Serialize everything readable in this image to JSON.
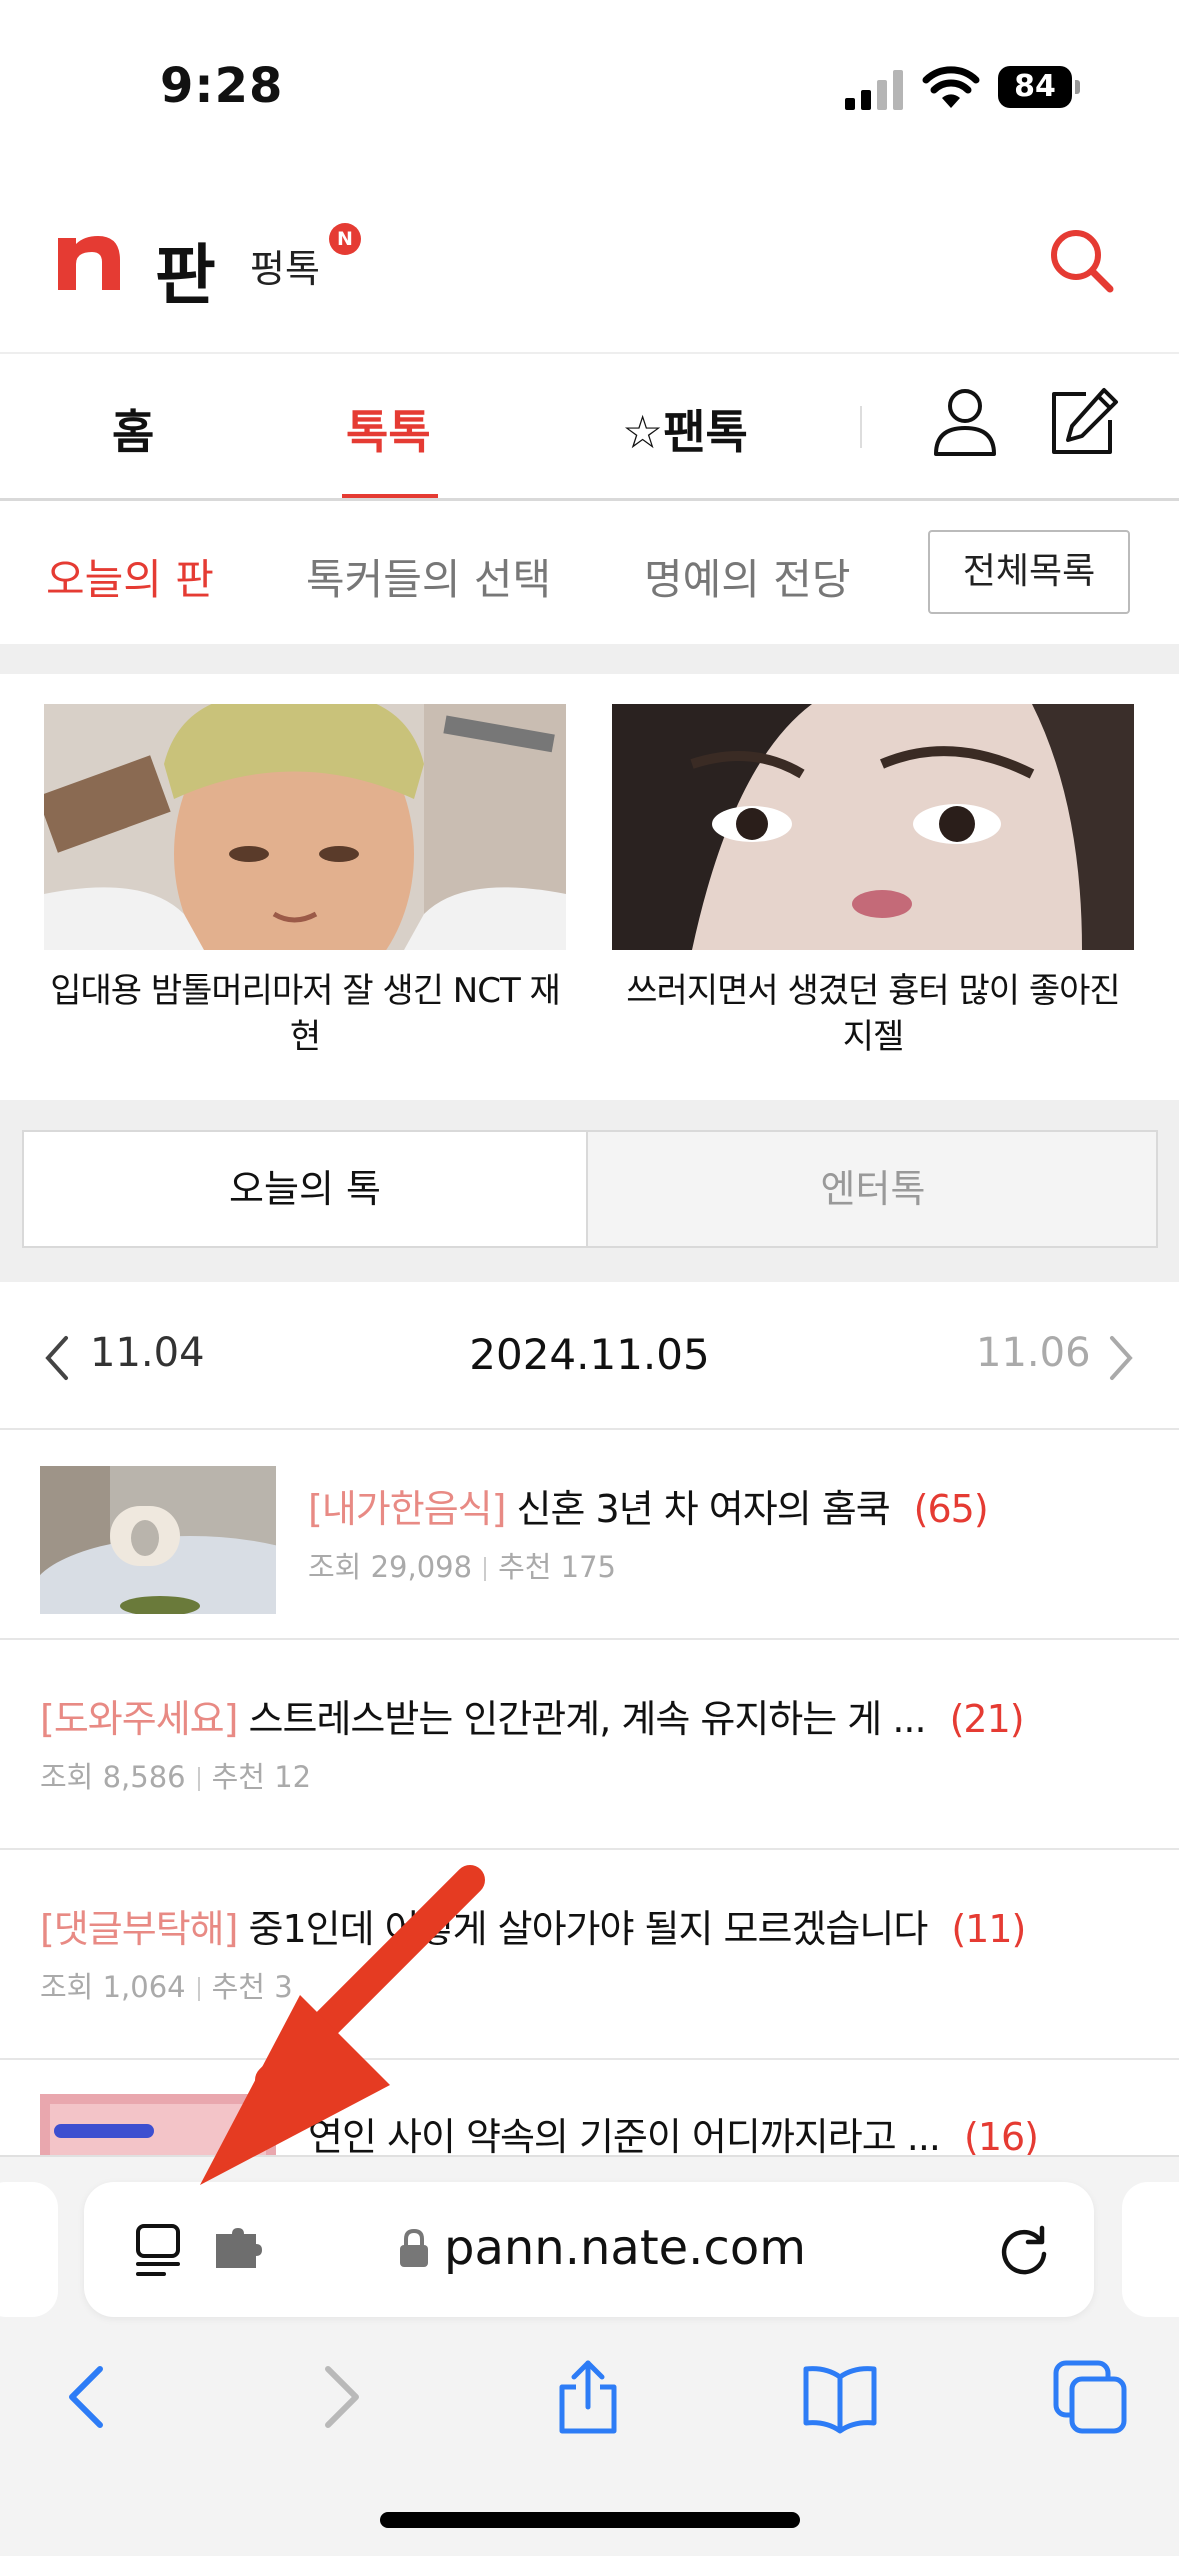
{
  "status": {
    "time": "9:28",
    "battery": "84"
  },
  "header": {
    "logo_main": "판",
    "logo_sub": "펑톡",
    "logo_badge": "N",
    "search_icon": "search-icon"
  },
  "nav": {
    "home": "홈",
    "talk": "톡톡",
    "fantalk": "☆팬톡",
    "user_icon": "user-icon",
    "write_icon": "write-icon"
  },
  "subnav": {
    "items": [
      "오늘의 판",
      "톡커들의 선택",
      "명예의 전당"
    ],
    "all": "전체목록"
  },
  "featured": [
    {
      "caption": "입대용 밤톨머리마저 잘 생긴 NCT 재현"
    },
    {
      "caption": "쓰러지면서 생겼던 흉터 많이 좋아진 지젤"
    }
  ],
  "tabs": [
    "오늘의 톡",
    "엔터톡"
  ],
  "date_nav": {
    "prev": "11.04",
    "current": "2024.11.05",
    "next": "11.06"
  },
  "list": [
    {
      "category": "[내가한음식]",
      "title": " 신혼 3년 차 여자의 홈쿡",
      "count": "(65)",
      "views": "조회 29,098",
      "recommend": "추천 175"
    },
    {
      "category": "[도와주세요]",
      "title": " 스트레스받는 인간관계, 계속 유지하는 게 ...",
      "count": "(21)",
      "views": "조회 8,586",
      "recommend": "추천 12"
    },
    {
      "category": "[댓글부탁해]",
      "title": " 중1인데 어떻게 살아가야 될지 모르겠습니다",
      "count": "(11)",
      "views": "조회 1,064",
      "recommend": "추천 3"
    },
    {
      "category": "",
      "title": "연인 사이 약속의 기준이 어디까지라고 ...",
      "count": "(16)",
      "views": "",
      "recommend": ""
    }
  ],
  "browser": {
    "url": "pann.nate.com"
  },
  "colors": {
    "accent": "#e53b33",
    "category": "#e88a84",
    "ios_blue": "#2d7cf6"
  }
}
